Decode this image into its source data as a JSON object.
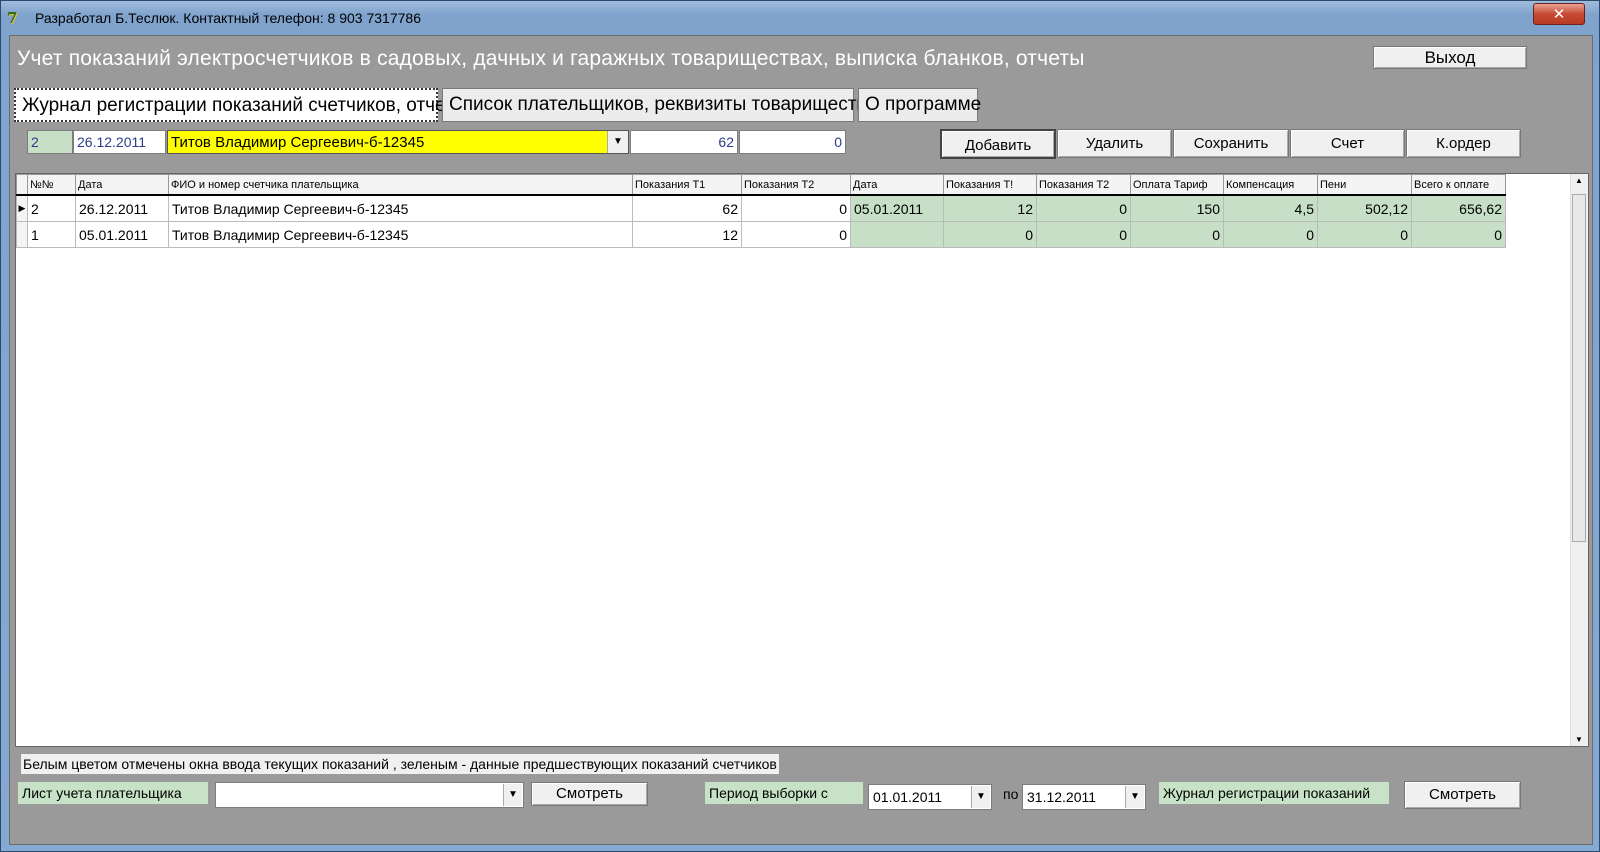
{
  "window": {
    "title": "Разработал Б.Теслюк. Контактный телефон: 8 903 7317786",
    "app_icon": "7",
    "close_glyph": "✕"
  },
  "header": {
    "title": "Учет показаний электросчетчиков  в садовых, дачных и гаражных товариществах, выписка бланков, отчеты",
    "exit_label": "Выход"
  },
  "tabs": [
    {
      "label": "Журнал регистрации показаний счетчиков, отчеты",
      "active": true
    },
    {
      "label": "Список плательщиков, реквизиты товарищества",
      "active": false
    },
    {
      "label": "О программе",
      "active": false
    }
  ],
  "entry": {
    "id": "2",
    "date": "26.12.2011",
    "payer": "Титов Владимир Сергеевич-б-12345",
    "t1": "62",
    "t2": "0"
  },
  "actions": {
    "add": "Добавить",
    "delete": "Удалить",
    "save": "Сохранить",
    "invoice": "Счет",
    "order": "К.ордер"
  },
  "table": {
    "columns": [
      "№№",
      "Дата",
      "ФИО и номер счетчика плательщика",
      "Показания Т1",
      "Показания Т2",
      "Дата",
      "Показания Т!",
      "Показания Т2",
      "Оплата Тариф",
      "Компенсация",
      "Пени",
      "Всего к оплате"
    ],
    "rows": [
      {
        "indicator": "▶",
        "cells": [
          "2",
          "26.12.2011",
          "Титов Владимир Сергеевич-б-12345",
          "62",
          "0",
          "05.01.2011",
          "12",
          "0",
          "150",
          "4,5",
          "502,12",
          "656,62"
        ]
      },
      {
        "indicator": "",
        "cells": [
          "1",
          "05.01.2011",
          "Титов Владимир Сергеевич-б-12345",
          "12",
          "0",
          "",
          "0",
          "0",
          "0",
          "0",
          "0",
          "0"
        ]
      }
    ]
  },
  "footer": {
    "note": "Белым цветом отмечены окна ввода текущих показаний , зеленым - данные предшествующих показаний счетчиков",
    "payer_sheet_label": "Лист учета плательщика",
    "payer_sheet_value": "",
    "view1": "Смотреть",
    "period_label": "Период выборки с",
    "period_from": "01.01.2011",
    "period_to_label": "по",
    "period_to": "31.12.2011",
    "journal_label": "Журнал регистрации показаний",
    "view2": "Смотреть"
  },
  "colors": {
    "accent_yellow": "#ffff00",
    "green_cells": "#c6dfc6",
    "title_bar": "#86a9d2"
  }
}
